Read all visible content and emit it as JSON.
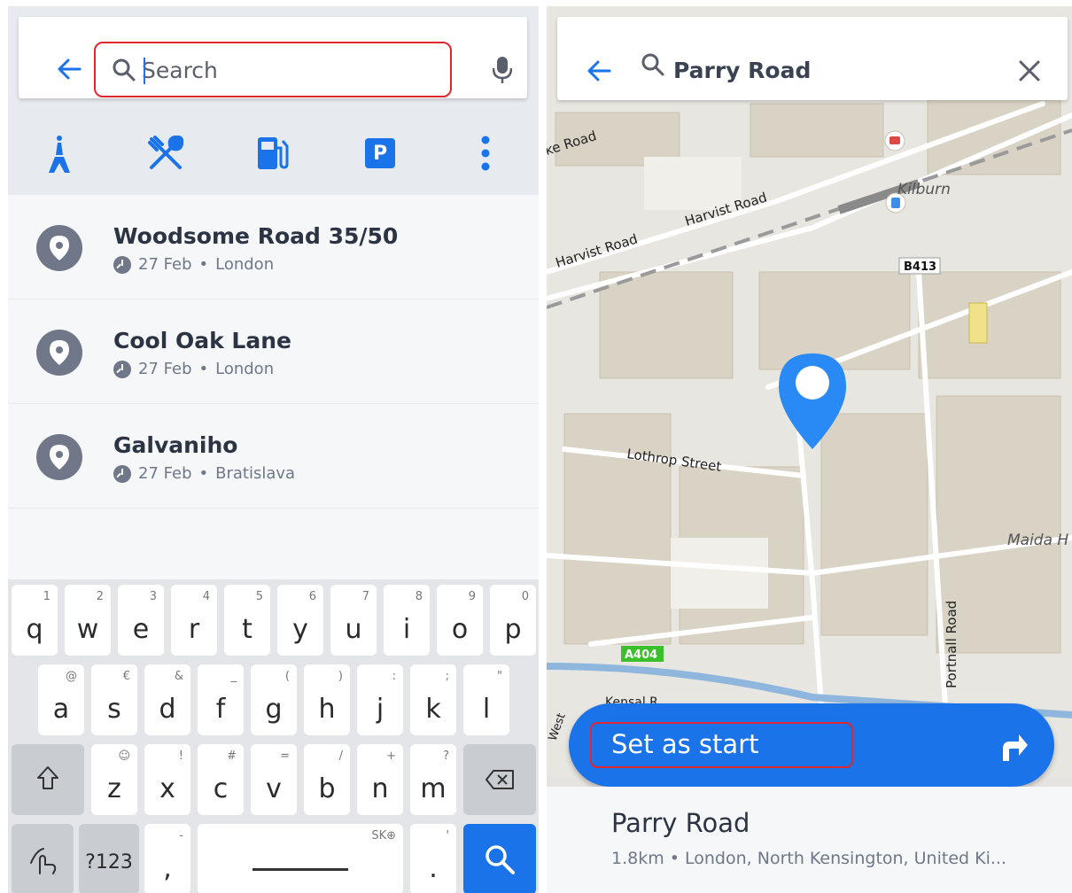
{
  "left": {
    "search": {
      "placeholder": "Search"
    },
    "categories": [
      {
        "icon": "tourism-icon"
      },
      {
        "icon": "restaurant-icon"
      },
      {
        "icon": "fuel-station-icon"
      },
      {
        "icon": "parking-icon",
        "label": "P"
      },
      {
        "icon": "more-vertical-icon"
      }
    ],
    "recent": [
      {
        "title": "Woodsome Road 35/50",
        "date": "27 Feb",
        "city": "London"
      },
      {
        "title": "Cool Oak Lane",
        "date": "27 Feb",
        "city": "London"
      },
      {
        "title": "Galvaniho",
        "date": "27 Feb",
        "city": "Bratislava"
      }
    ],
    "keyboard": {
      "row1": [
        {
          "k": "q",
          "s": "1"
        },
        {
          "k": "w",
          "s": "2"
        },
        {
          "k": "e",
          "s": "3"
        },
        {
          "k": "r",
          "s": "4"
        },
        {
          "k": "t",
          "s": "5"
        },
        {
          "k": "y",
          "s": "6"
        },
        {
          "k": "u",
          "s": "7"
        },
        {
          "k": "i",
          "s": "8"
        },
        {
          "k": "o",
          "s": "9"
        },
        {
          "k": "p",
          "s": "0"
        }
      ],
      "row2": [
        {
          "k": "a",
          "s": "@"
        },
        {
          "k": "s",
          "s": "€"
        },
        {
          "k": "d",
          "s": "&"
        },
        {
          "k": "f",
          "s": "_"
        },
        {
          "k": "g",
          "s": "("
        },
        {
          "k": "h",
          "s": ")"
        },
        {
          "k": "j",
          "s": ":"
        },
        {
          "k": "k",
          "s": ";"
        },
        {
          "k": "l",
          "s": "\""
        }
      ],
      "row3": [
        {
          "k": "z",
          "s": "☺"
        },
        {
          "k": "x",
          "s": "!"
        },
        {
          "k": "c",
          "s": "#"
        },
        {
          "k": "v",
          "s": "="
        },
        {
          "k": "b",
          "s": "/"
        },
        {
          "k": "n",
          "s": "+"
        },
        {
          "k": "m",
          "s": "?"
        }
      ],
      "numeric": "?123",
      "comma": ",",
      "comma_sup": "-",
      "space_sup": "SK⊕",
      "period": ".",
      "period_sup": "'"
    }
  },
  "right": {
    "search": {
      "query": "Parry Road"
    },
    "map_labels": {
      "road1": "Harvist Road",
      "road2": "Harvist Road",
      "road3": "ke Road",
      "kilburn": "Kilburn",
      "b413": "B413",
      "lothrop": "Lothrop Street",
      "maida": "Maida H",
      "a404": "A404",
      "portnall": "Portnall Road",
      "kensal": "Kensal R",
      "west": "West"
    },
    "action": {
      "label": "Set as start"
    },
    "place": {
      "name": "Parry Road",
      "address": "1.8km • London, North Kensington, United Ki..."
    },
    "colors": {
      "accent": "#1a73e8",
      "highlight": "#e0262e",
      "a404": "#3bbf2a"
    }
  }
}
